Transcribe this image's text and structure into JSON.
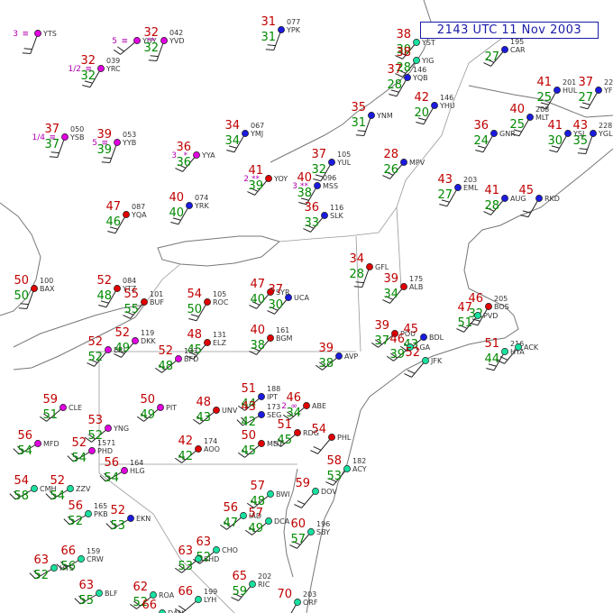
{
  "title": "2143 UTC 11 Nov 2003",
  "colors": {
    "temperature": "#c00000",
    "dewpoint": "#008a00",
    "weather": "#b000b0",
    "stamp": "#1a1aa8",
    "sky_clear": "#18e0a0",
    "sky_cloudy": "#1a1ae0",
    "sky_overcast": "#e00000",
    "sky_missing": "#e000e0"
  },
  "stations": [
    {
      "id": "YTS",
      "t": "",
      "d": "",
      "wx": "≡",
      "n": "3",
      "sky": "sky_missing"
    },
    {
      "id": "YUY",
      "t": "",
      "d": "",
      "wx": "≡",
      "n": "5",
      "sky": "sky_missing"
    },
    {
      "id": "YVD",
      "t": "32",
      "d": "32",
      "wx": "**",
      "p": "042",
      "sky": "sky_missing"
    },
    {
      "id": "YPK",
      "t": "31",
      "d": "31",
      "p": "077",
      "sky": "sky_cloudy"
    },
    {
      "id": "YST",
      "t": "38",
      "d": "30",
      "p": "",
      "sky": "sky_clear"
    },
    {
      "id": "CAR",
      "t": "",
      "d": "27",
      "p": "195",
      "sky": "sky_cloudy"
    },
    {
      "id": "YRC",
      "t": "32",
      "d": "32",
      "p": "039",
      "wx": "≡",
      "n": "1/2",
      "sky": "sky_missing"
    },
    {
      "id": "YIG",
      "t": "38",
      "d": "28",
      "p": "",
      "sky": "sky_clear"
    },
    {
      "id": "HUL",
      "t": "41",
      "d": "25",
      "p": "201",
      "sky": "sky_cloudy"
    },
    {
      "id": "YFC",
      "t": "37",
      "d": "27",
      "p": "224",
      "sky": "sky_cloudy"
    },
    {
      "id": "YQB",
      "t": "37",
      "d": "28",
      "p": "146",
      "sky": "sky_cloudy"
    },
    {
      "id": "YHU",
      "t": "42",
      "d": "20",
      "p": "146",
      "sky": "sky_cloudy"
    },
    {
      "id": "YSB",
      "t": "37",
      "d": "37",
      "p": "050",
      "wx": "≡",
      "n": "1/4",
      "sky": "sky_missing"
    },
    {
      "id": "YYB",
      "t": "39",
      "d": "39",
      "p": "053",
      "wx": "≡",
      "n": "5",
      "sky": "sky_missing"
    },
    {
      "id": "YMJ",
      "t": "34",
      "d": "34",
      "p": "067",
      "sky": "sky_cloudy"
    },
    {
      "id": "YNM",
      "t": "35",
      "d": "31",
      "p": "",
      "sky": "sky_cloudy"
    },
    {
      "id": "GNR",
      "t": "36",
      "d": "24",
      "p": "",
      "sky": "sky_cloudy"
    },
    {
      "id": "MLT",
      "t": "40",
      "d": "25",
      "p": "208",
      "sky": "sky_cloudy"
    },
    {
      "id": "YSJ",
      "t": "41",
      "d": "30",
      "p": "",
      "sky": "sky_cloudy"
    },
    {
      "id": "YGL",
      "t": "43",
      "d": "35",
      "p": "228",
      "sky": "sky_cloudy"
    },
    {
      "id": "YYA",
      "t": "36",
      "d": "36",
      "p": "",
      "wx": "*",
      "n": "3",
      "sky": "sky_missing"
    },
    {
      "id": "YUL",
      "t": "37",
      "d": "32",
      "p": "105",
      "sky": "sky_cloudy"
    },
    {
      "id": "YRK",
      "t": "40",
      "d": "40",
      "p": "074",
      "sky": "sky_cloudy"
    },
    {
      "id": "YOY",
      "t": "41",
      "d": "39",
      "p": "",
      "wx": "**",
      "n": "2",
      "sky": "sky_overcast"
    },
    {
      "id": "MSS",
      "t": "40",
      "d": "38",
      "p": "096",
      "wx": "**",
      "n": "3",
      "sky": "sky_cloudy"
    },
    {
      "id": "SLK",
      "t": "36",
      "d": "33",
      "p": "116",
      "sky": "sky_cloudy"
    },
    {
      "id": "MPV",
      "t": "28",
      "d": "26",
      "p": "",
      "sky": "sky_cloudy"
    },
    {
      "id": "EML",
      "t": "43",
      "d": "27",
      "p": "203",
      "sky": "sky_cloudy"
    },
    {
      "id": "AUG",
      "t": "41",
      "d": "28",
      "p": "",
      "sky": "sky_cloudy"
    },
    {
      "id": "RKD",
      "t": "45",
      "d": "",
      "p": "",
      "sky": "sky_cloudy"
    },
    {
      "id": "YQA",
      "t": "47",
      "d": "46",
      "p": "087",
      "sky": "sky_overcast"
    },
    {
      "id": "GFL",
      "t": "34",
      "d": "28",
      "p": "",
      "sky": "sky_overcast"
    },
    {
      "id": "ALB",
      "t": "39",
      "d": "34",
      "p": "175",
      "sky": "sky_overcast"
    },
    {
      "id": "BOS",
      "t": "46",
      "d": "32",
      "p": "205",
      "sky": "sky_overcast"
    },
    {
      "id": "BDL",
      "t": "45",
      "d": "43",
      "p": "",
      "sky": "sky_cloudy"
    },
    {
      "id": "PVD",
      "t": "47",
      "d": "51",
      "p": "",
      "sky": "sky_clear"
    },
    {
      "id": "HYA",
      "t": "51",
      "d": "44",
      "p": "216",
      "sky": "sky_clear"
    },
    {
      "id": "ACK",
      "t": "",
      "d": "",
      "p": "",
      "sky": "sky_clear"
    },
    {
      "id": "BAX",
      "t": "50",
      "d": "50",
      "p": "100",
      "sky": "sky_overcast"
    },
    {
      "id": "YTZ",
      "t": "52",
      "d": "48",
      "p": "084",
      "sky": "sky_overcast"
    },
    {
      "id": "BUF",
      "t": "55",
      "d": "55",
      "p": "101",
      "sky": "sky_overcast"
    },
    {
      "id": "ROC",
      "t": "54",
      "d": "50",
      "p": "105",
      "sky": "sky_overcast"
    },
    {
      "id": "SYR",
      "t": "47",
      "d": "40",
      "p": "",
      "sky": "sky_overcast"
    },
    {
      "id": "UCA",
      "t": "37",
      "d": "30",
      "p": "",
      "sky": "sky_cloudy"
    },
    {
      "id": "ELZ",
      "t": "48",
      "d": "45",
      "p": "131",
      "sky": "sky_overcast"
    },
    {
      "id": "BGM",
      "t": "40",
      "d": "38",
      "p": "161",
      "sky": "sky_overcast"
    },
    {
      "id": "AVP",
      "t": "39",
      "d": "38",
      "p": "",
      "sky": "sky_cloudy"
    },
    {
      "id": "POU",
      "t": "39",
      "d": "37",
      "p": "",
      "sky": "sky_overcast"
    },
    {
      "id": "LGA",
      "t": "46",
      "d": "39",
      "p": "",
      "sky": "sky_clear"
    },
    {
      "id": "JFK",
      "t": "52",
      "d": "",
      "p": "",
      "sky": "sky_clear"
    },
    {
      "id": "IPT",
      "t": "51",
      "d": "44",
      "p": "188",
      "sky": "sky_cloudy"
    },
    {
      "id": "SEG",
      "t": "43",
      "d": "42",
      "p": "173",
      "sky": "sky_cloudy"
    },
    {
      "id": "UNV",
      "t": "48",
      "d": "43",
      "p": "",
      "sky": "sky_overcast"
    },
    {
      "id": "ABE",
      "t": "46",
      "d": "34",
      "p": "",
      "wx": "∞",
      "n": "2",
      "sky": "sky_overcast"
    },
    {
      "id": "PHL",
      "t": "54",
      "d": "",
      "p": "",
      "sky": "sky_overcast"
    },
    {
      "id": "RDG",
      "t": "51",
      "d": "45",
      "p": "",
      "sky": "sky_overcast"
    },
    {
      "id": "MDT",
      "t": "50",
      "d": "45",
      "p": "",
      "sky": "sky_overcast"
    },
    {
      "id": "ACY",
      "t": "58",
      "d": "53",
      "p": "182",
      "sky": "sky_clear"
    },
    {
      "id": "PIT",
      "t": "50",
      "d": "49",
      "p": "",
      "sky": "sky_missing"
    },
    {
      "id": "AOO",
      "t": "42",
      "d": "42",
      "p": "174",
      "sky": "sky_overcast"
    },
    {
      "id": "CLE",
      "t": "59",
      "d": "51",
      "p": "",
      "sky": "sky_missing"
    },
    {
      "id": "YNG",
      "t": "53",
      "d": "52",
      "p": "",
      "sky": "sky_missing"
    },
    {
      "id": "ERI",
      "t": "52",
      "d": "52",
      "p": "",
      "sky": "sky_missing"
    },
    {
      "id": "DKK",
      "t": "52",
      "d": "49",
      "p": "119",
      "sky": "sky_missing"
    },
    {
      "id": "BFD",
      "t": "52",
      "d": "48",
      "p": "133",
      "sky": "sky_missing"
    },
    {
      "id": "MFD",
      "t": "56",
      "d": "54",
      "p": "",
      "sky": "sky_missing"
    },
    {
      "id": "PHD",
      "t": "52",
      "d": "54",
      "p": "1571",
      "sky": "sky_missing"
    },
    {
      "id": "HLG",
      "t": "56",
      "d": "54",
      "p": "164",
      "sky": "sky_missing"
    },
    {
      "id": "CMH",
      "t": "54",
      "d": "58",
      "p": "",
      "sky": "sky_clear"
    },
    {
      "id": "ZZV",
      "t": "52",
      "d": "54",
      "p": "",
      "sky": "sky_clear"
    },
    {
      "id": "PKB",
      "t": "56",
      "d": "52",
      "p": "165",
      "sky": "sky_clear"
    },
    {
      "id": "EKN",
      "t": "52",
      "d": "53",
      "p": "",
      "sky": "sky_cloudy"
    },
    {
      "id": "CRW",
      "t": "66",
      "d": "56",
      "p": "159",
      "sky": "sky_clear"
    },
    {
      "id": "HTS",
      "t": "63",
      "d": "52",
      "p": "",
      "sky": "sky_clear"
    },
    {
      "id": "BLF",
      "t": "63",
      "d": "55",
      "p": "",
      "sky": "sky_clear"
    },
    {
      "id": "IAD",
      "t": "56",
      "d": "47",
      "p": "",
      "sky": "sky_clear"
    },
    {
      "id": "DCA",
      "t": "57",
      "d": "49",
      "p": "",
      "sky": "sky_clear"
    },
    {
      "id": "BWI",
      "t": "57",
      "d": "48",
      "p": "",
      "sky": "sky_clear"
    },
    {
      "id": "DOV",
      "t": "59",
      "d": "",
      "p": "",
      "sky": "sky_clear"
    },
    {
      "id": "SBY",
      "t": "60",
      "d": "57",
      "p": "196",
      "sky": "sky_clear"
    },
    {
      "id": "RIC",
      "t": "65",
      "d": "59",
      "p": "202",
      "sky": "sky_clear"
    },
    {
      "id": "ORF",
      "t": "70",
      "d": "",
      "p": "203",
      "sky": "sky_clear"
    },
    {
      "id": "ROA",
      "t": "62",
      "d": "52",
      "p": "",
      "sky": "sky_clear"
    },
    {
      "id": "LYH",
      "t": "66",
      "d": "",
      "p": "199",
      "sky": "sky_clear"
    },
    {
      "id": "CHO",
      "t": "63",
      "d": "52",
      "p": "",
      "sky": "sky_clear"
    },
    {
      "id": "SHD",
      "t": "63",
      "d": "53",
      "p": "",
      "sky": "sky_clear"
    },
    {
      "id": "DAN",
      "t": "66",
      "d": "",
      "p": "",
      "sky": "sky_clear"
    }
  ]
}
